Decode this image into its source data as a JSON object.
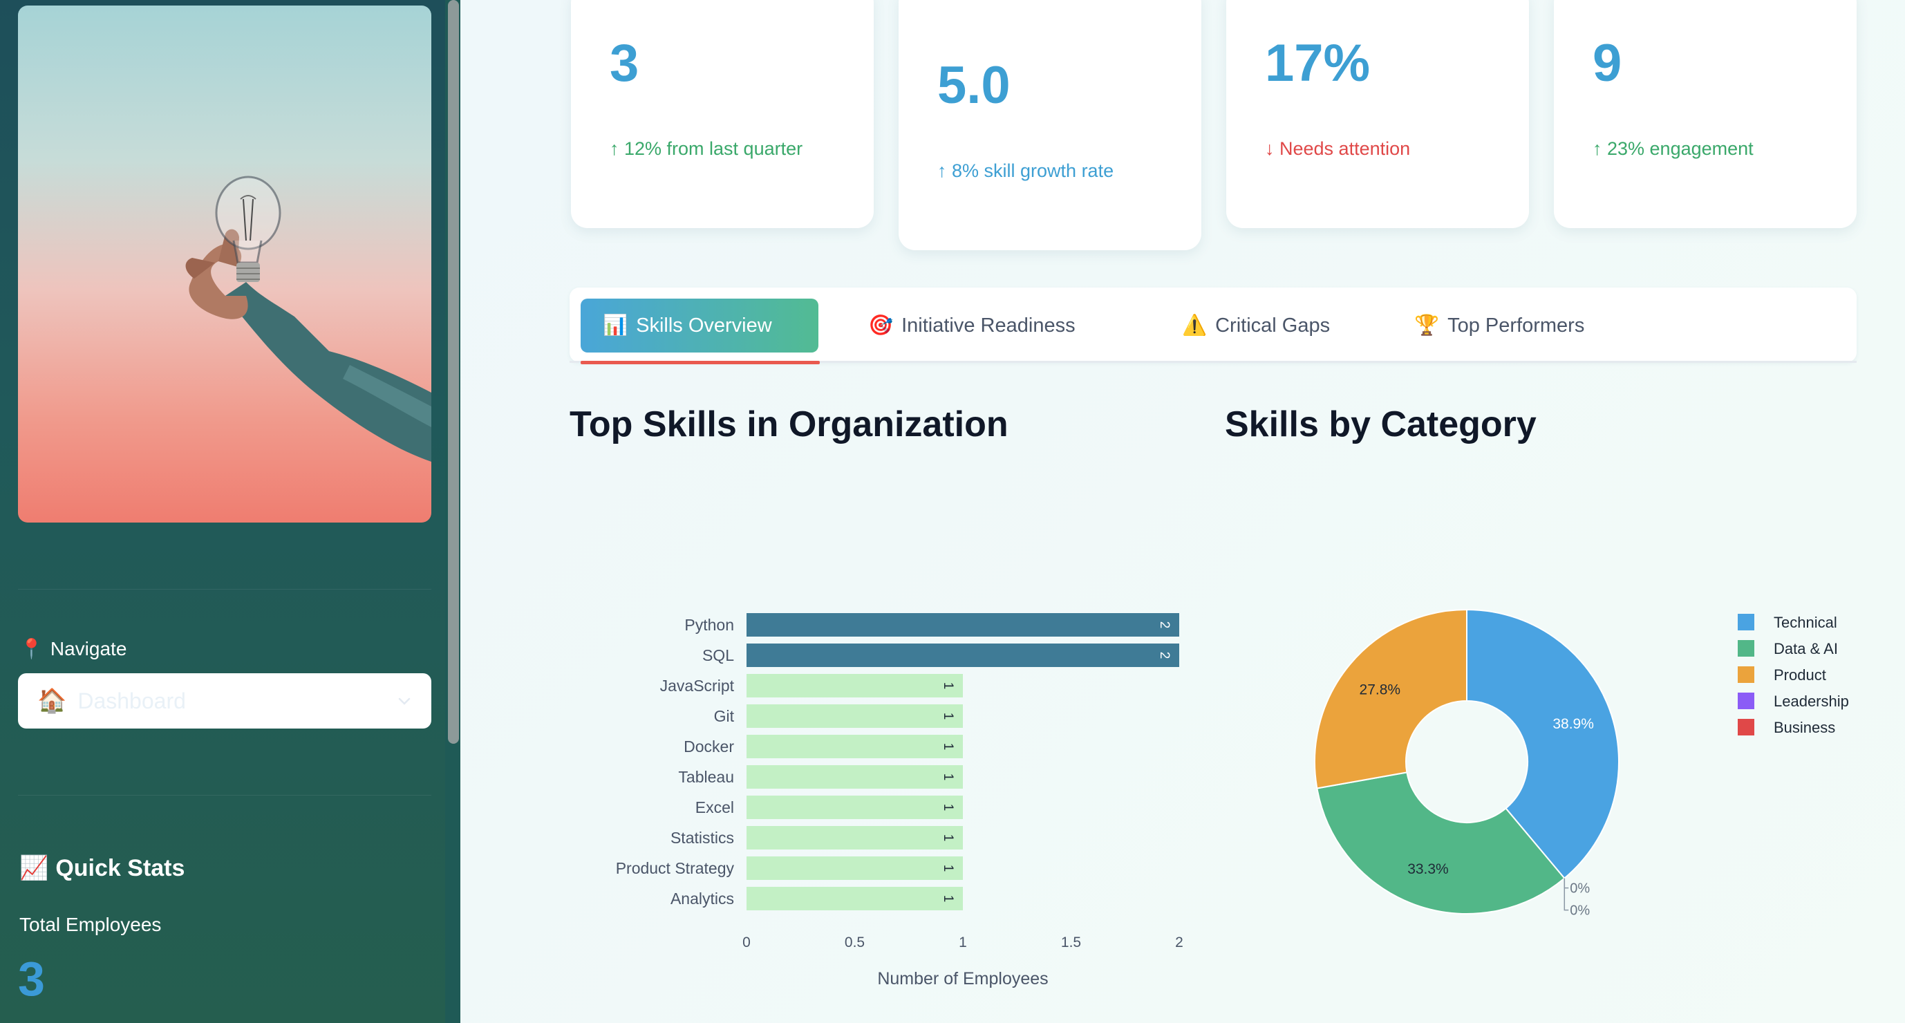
{
  "sidebar": {
    "navigate_label": "Navigate",
    "navigate_icon": "pin-icon",
    "select": {
      "icon": "house-icon",
      "value": "Dashboard"
    },
    "quick_stats": {
      "title": "Quick Stats",
      "icon": "chart-up-icon",
      "label": "Total Employees",
      "value": "3"
    }
  },
  "metrics": [
    {
      "value": "3",
      "delta": "↑ 12% from last quarter",
      "trend": "up"
    },
    {
      "value": "5.0",
      "delta": "↑ 8% skill growth rate",
      "trend": "up"
    },
    {
      "value": "17%",
      "delta": "↓ Needs attention",
      "trend": "down"
    },
    {
      "value": "9",
      "delta": "↑ 23% engagement",
      "trend": "up"
    }
  ],
  "tabs": [
    {
      "icon": "📊",
      "label": "Skills Overview",
      "active": true
    },
    {
      "icon": "🎯",
      "label": "Initiative Readiness",
      "active": false
    },
    {
      "icon": "⚠️",
      "label": "Critical Gaps",
      "active": false
    },
    {
      "icon": "🏆",
      "label": "Top Performers",
      "active": false
    }
  ],
  "sections": {
    "top_skills_title": "Top Skills in Organization",
    "category_title": "Skills by Category"
  },
  "colors": {
    "accent_blue": "#3d9fd3",
    "bar_dark": "#3f7b96",
    "bar_light": "#c3f0c5",
    "up": "#3aa86a",
    "down": "#e04848"
  },
  "chart_data": [
    {
      "type": "bar",
      "orientation": "horizontal",
      "categories": [
        "Python",
        "SQL",
        "JavaScript",
        "Git",
        "Docker",
        "Tableau",
        "Excel",
        "Statistics",
        "Product Strategy",
        "Analytics"
      ],
      "values": [
        2,
        2,
        1,
        1,
        1,
        1,
        1,
        1,
        1,
        1
      ],
      "data_labels": [
        "2",
        "2",
        "1",
        "1",
        "1",
        "1",
        "1",
        "1",
        "1",
        "1"
      ],
      "xlabel": "Number of Employees",
      "ylabel": "",
      "xlim": [
        0,
        2
      ],
      "x_ticks": [
        "0",
        "0.5",
        "1",
        "1.5",
        "2"
      ],
      "grid": false
    },
    {
      "type": "pie",
      "donut": true,
      "labels": [
        "Technical",
        "Data & AI",
        "Product",
        "Leadership",
        "Business"
      ],
      "values": [
        38.9,
        33.3,
        27.8,
        0,
        0
      ],
      "data_labels": [
        "38.9%",
        "33.3%",
        "27.8%",
        "0%",
        "0%"
      ],
      "colors": [
        "#4aa3e2",
        "#52b788",
        "#eba33c",
        "#8b5cf6",
        "#e04848"
      ],
      "legend": "right"
    }
  ]
}
